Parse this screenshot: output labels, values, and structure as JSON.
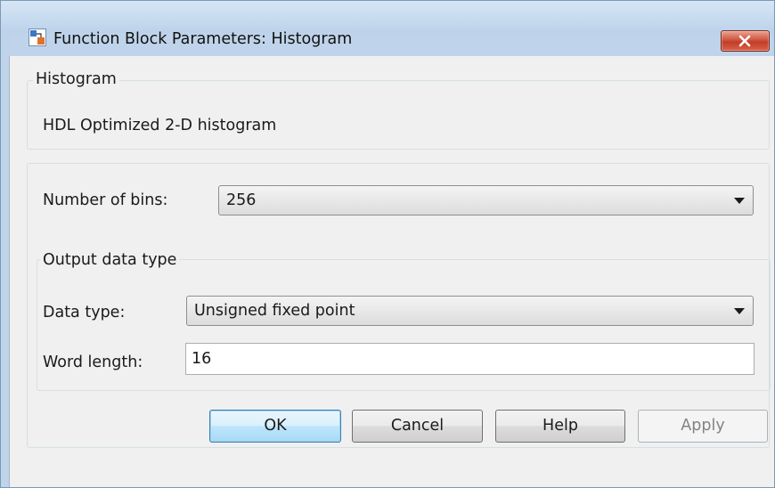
{
  "window": {
    "title": "Function Block Parameters: Histogram",
    "close_icon": "close-icon"
  },
  "description": {
    "group_label": "Histogram",
    "text": "HDL Optimized 2-D histogram"
  },
  "parameters": {
    "bins_label": "Number of bins:",
    "bins_value": "256"
  },
  "output_data_type": {
    "group_label": "Output data type",
    "data_type_label": "Data type:",
    "data_type_value": "Unsigned fixed point",
    "word_length_label": "Word length:",
    "word_length_value": "16"
  },
  "buttons": {
    "ok": "OK",
    "cancel": "Cancel",
    "help": "Help",
    "apply": "Apply"
  },
  "colors": {
    "close_button": "#c74a33",
    "window_frame": "#bfd4ea",
    "primary_button": "#bee6fd"
  }
}
